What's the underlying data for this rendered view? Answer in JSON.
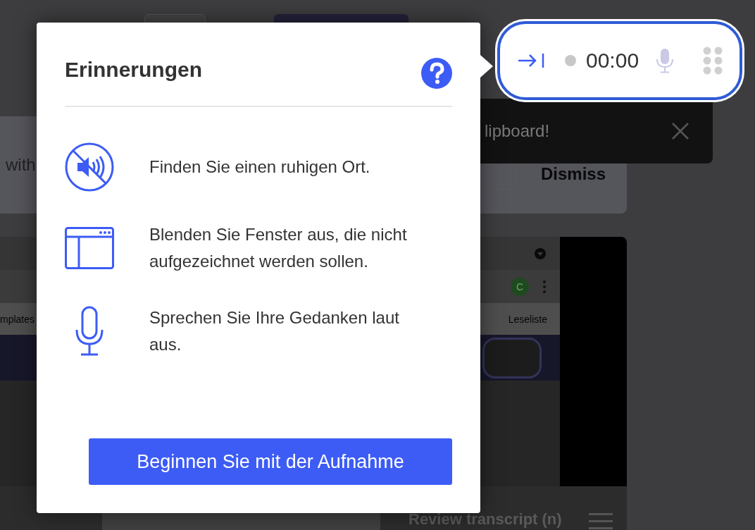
{
  "background": {
    "banner": {
      "text": "with",
      "dismiss": "Dismiss"
    },
    "toast": {
      "text": "lipboard!"
    },
    "browser": {
      "avatar": "C",
      "bookmarks": [
        "mplates",
        "Leseliste"
      ]
    },
    "transcript": {
      "title": "Review transcript (n)"
    }
  },
  "dialog": {
    "title": "Erinnerungen",
    "tips": [
      {
        "kind": "quiet",
        "text": "Finden Sie einen ruhigen Ort."
      },
      {
        "kind": "window",
        "text": "Blenden Sie Fenster aus, die nicht aufgezeichnet werden sollen."
      },
      {
        "kind": "mic",
        "text": "Sprechen Sie Ihre Gedanken laut aus."
      }
    ],
    "button": "Beginnen Sie mit der Aufnahme"
  },
  "recorder": {
    "time": "00:00"
  }
}
